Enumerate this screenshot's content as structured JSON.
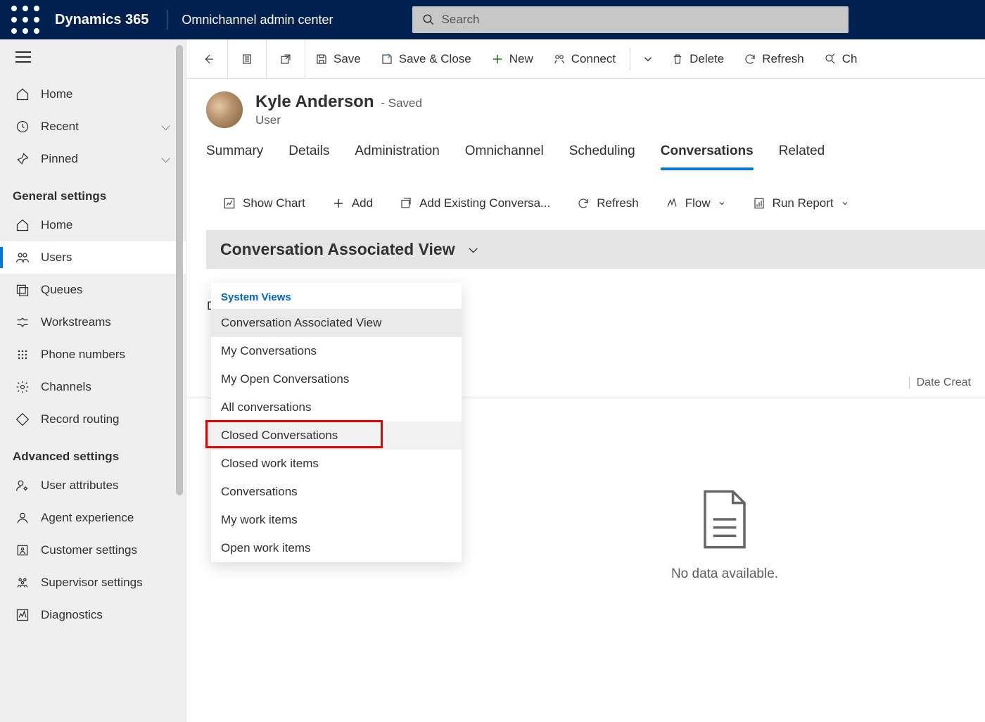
{
  "app": {
    "brand": "Dynamics 365",
    "subbrand": "Omnichannel admin center",
    "search_placeholder": "Search"
  },
  "sidebar": {
    "items_top": [
      {
        "icon": "home",
        "label": "Home",
        "chevron": false
      },
      {
        "icon": "clock",
        "label": "Recent",
        "chevron": true
      },
      {
        "icon": "pin",
        "label": "Pinned",
        "chevron": true
      }
    ],
    "section1": "General settings",
    "items_general": [
      {
        "icon": "home",
        "label": "Home"
      },
      {
        "icon": "users",
        "label": "Users",
        "active": true
      },
      {
        "icon": "queues",
        "label": "Queues"
      },
      {
        "icon": "workstream",
        "label": "Workstreams"
      },
      {
        "icon": "dialpad",
        "label": "Phone numbers"
      },
      {
        "icon": "gear",
        "label": "Channels"
      },
      {
        "icon": "route",
        "label": "Record routing"
      }
    ],
    "section2": "Advanced settings",
    "items_advanced": [
      {
        "icon": "user-attr",
        "label": "User attributes"
      },
      {
        "icon": "agent",
        "label": "Agent experience"
      },
      {
        "icon": "customer",
        "label": "Customer settings"
      },
      {
        "icon": "supervisor",
        "label": "Supervisor settings"
      },
      {
        "icon": "diag",
        "label": "Diagnostics"
      }
    ]
  },
  "commands": {
    "save": "Save",
    "save_close": "Save & Close",
    "new": "New",
    "connect": "Connect",
    "delete": "Delete",
    "refresh": "Refresh",
    "check": "Ch"
  },
  "record": {
    "name": "Kyle Anderson",
    "status": "- Saved",
    "type": "User"
  },
  "tabs": [
    "Summary",
    "Details",
    "Administration",
    "Omnichannel",
    "Scheduling",
    "Conversations",
    "Related"
  ],
  "active_tab": "Conversations",
  "subcommands": {
    "show_chart": "Show Chart",
    "add": "Add",
    "add_existing": "Add Existing Conversa...",
    "refresh": "Refresh",
    "flow": "Flow",
    "run_report": "Run Report"
  },
  "view": {
    "current": "Conversation Associated View",
    "section_label": "System Views",
    "options": [
      "Conversation Associated View",
      "My Conversations",
      "My Open Conversations",
      "All conversations",
      "Closed Conversations",
      "Closed work items",
      "Conversations",
      "My work items",
      "Open work items"
    ],
    "selected_index": 0,
    "highlight_index": 4
  },
  "grid": {
    "col_right": "Date Creat",
    "empty": "No data available.",
    "left_letter": "D"
  }
}
